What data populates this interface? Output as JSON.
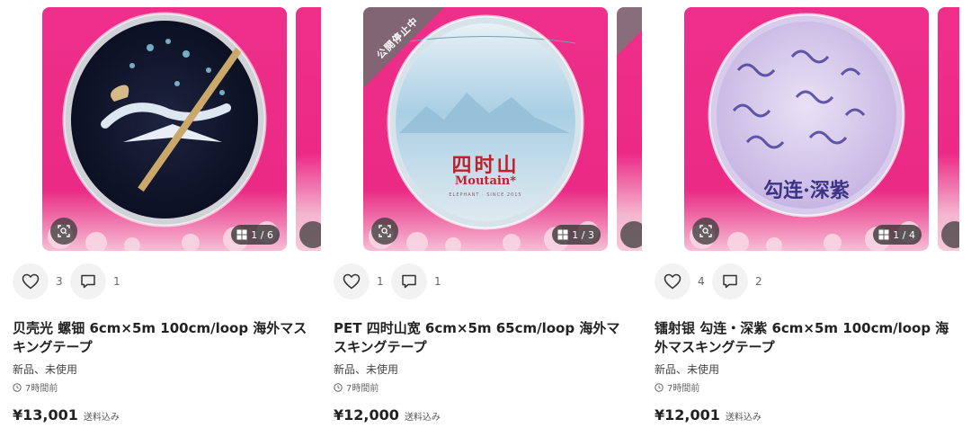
{
  "items": [
    {
      "title": "贝壳光 螺钿 6cm×5m 100cm/loop 海外マスキングテープ",
      "condition": "新品、未使用",
      "time_ago": "7時間前",
      "price": "¥13,001",
      "shipping": "送料込み",
      "likes": "3",
      "comments": "1",
      "image_counter": "1 / 6",
      "suspended_banner": ""
    },
    {
      "title": "PET 四时山宽 6cm×5m 65cm/loop 海外マスキングテープ",
      "condition": "新品、未使用",
      "time_ago": "7時間前",
      "price": "¥12,000",
      "shipping": "送料込み",
      "likes": "1",
      "comments": "1",
      "image_counter": "1 / 3",
      "suspended_banner": "公開停止中",
      "tape_label": "四时山",
      "tape_sublabel": "Moutain*",
      "tape_small": "ELEPHANT · SINCE 2015"
    },
    {
      "title": "镭射银 勾连・深紫 6cm×5m 100cm/loop 海外マスキングテープ",
      "condition": "新品、未使用",
      "time_ago": "7時間前",
      "price": "¥12,001",
      "shipping": "送料込み",
      "likes": "4",
      "comments": "2",
      "image_counter": "1 / 4",
      "suspended_banner": "",
      "tape_label": "勾连·深紫"
    }
  ],
  "icons": {
    "like": "heart-icon",
    "comment": "comment-icon",
    "scan": "image-search-icon",
    "gallery": "gallery-grid-icon",
    "clock": "clock-icon"
  },
  "colors": {
    "photo_bg": "#ec2a86",
    "banner": "#6e6e6e",
    "text": "#222222"
  }
}
